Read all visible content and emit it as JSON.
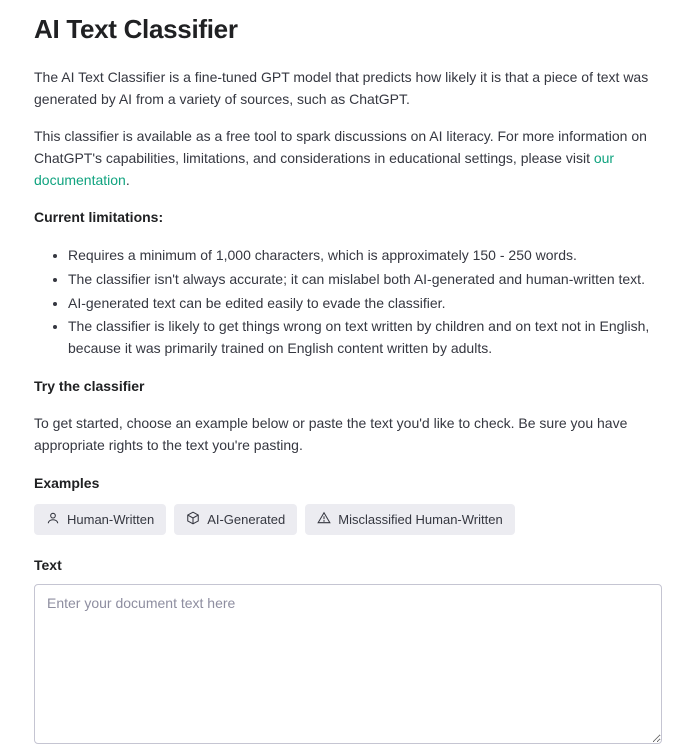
{
  "title": "AI Text Classifier",
  "intro": "The AI Text Classifier is a fine-tuned GPT model that predicts how likely it is that a piece of text was generated by AI from a variety of sources, such as ChatGPT.",
  "avail_pre": "This classifier is available as a free tool to spark discussions on AI literacy. For more information on ChatGPT's capabilities, limitations, and considerations in educational settings, please visit ",
  "avail_link": "our documentation",
  "avail_post": ".",
  "limitations_heading": "Current limitations:",
  "limitations": [
    "Requires a minimum of 1,000 characters, which is approximately 150 - 250 words.",
    "The classifier isn't always accurate; it can mislabel both AI-generated and human-written text.",
    "AI-generated text can be edited easily to evade the classifier.",
    "The classifier is likely to get things wrong on text written by children and on text not in English, because it was primarily trained on English content written by adults."
  ],
  "try_heading": "Try the classifier",
  "try_desc": "To get started, choose an example below or paste the text you'd like to check. Be sure you have appropriate rights to the text you're pasting.",
  "examples_label": "Examples",
  "chips": {
    "human": "Human-Written",
    "ai": "AI-Generated",
    "mis": "Misclassified Human-Written"
  },
  "text_label": "Text",
  "text_placeholder": "Enter your document text here"
}
